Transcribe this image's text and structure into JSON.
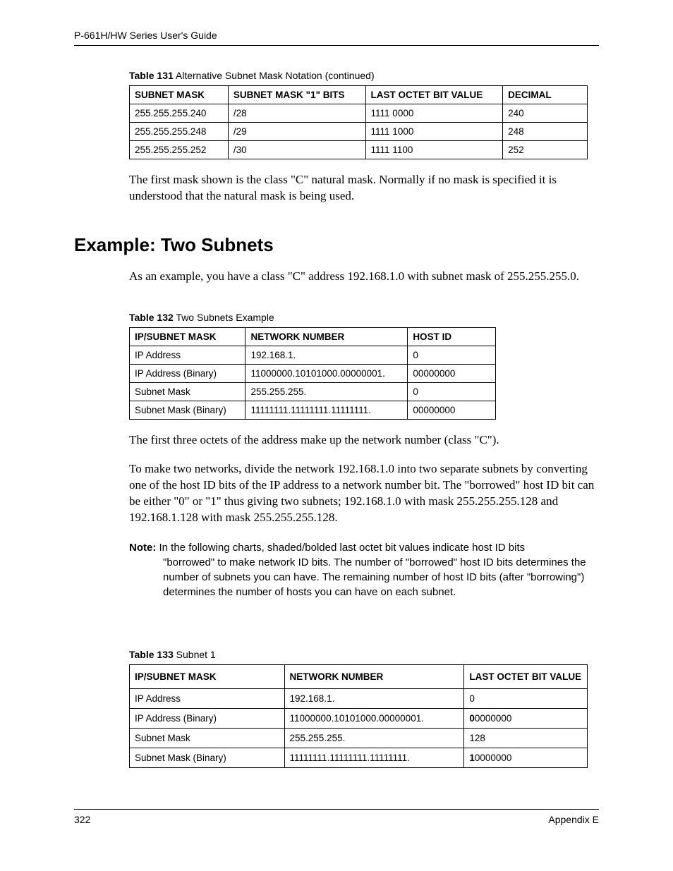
{
  "header": {
    "title": "P-661H/HW Series User's Guide"
  },
  "footer": {
    "page_number": "322",
    "section": "Appendix E"
  },
  "table131": {
    "caption_bold": "Table 131",
    "caption_text": "   Alternative Subnet Mask Notation (continued)",
    "headers": [
      "SUBNET MASK",
      "SUBNET MASK \"1\" BITS",
      "LAST OCTET BIT VALUE",
      "DECIMAL"
    ],
    "rows": [
      [
        "255.255.255.240",
        "/28",
        "1111 0000",
        "240"
      ],
      [
        "255.255.255.248",
        "/29",
        "1111 1000",
        "248"
      ],
      [
        "255.255.255.252",
        "/30",
        "1111 1100",
        "252"
      ]
    ]
  },
  "para1": "The first mask shown is the class \"C\" natural mask. Normally if no mask is specified it is understood that the natural mask is being used.",
  "h2_title": "Example: Two Subnets",
  "para2": "As an example, you have a class \"C\" address 192.168.1.0 with subnet mask of 255.255.255.0.",
  "table132": {
    "caption_bold": "Table 132",
    "caption_text": "   Two Subnets Example",
    "headers": [
      "IP/SUBNET MASK",
      "NETWORK NUMBER",
      "HOST ID"
    ],
    "rows": [
      [
        "IP Address",
        "192.168.1.",
        "0"
      ],
      [
        "IP Address (Binary)",
        "11000000.10101000.00000001.",
        "00000000"
      ],
      [
        "Subnet Mask",
        "255.255.255.",
        "0"
      ],
      [
        "Subnet Mask (Binary)",
        "11111111.11111111.11111111.",
        "00000000"
      ]
    ]
  },
  "para3": "The first three octets of the address make up the network number (class \"C\").",
  "para4": "To make two networks, divide the network 192.168.1.0 into two separate subnets by converting one of the host ID bits of the IP address to a network number bit. The \"borrowed\" host ID bit can be either \"0\" or \"1\" thus giving two subnets; 192.168.1.0 with mask 255.255.255.128 and 192.168.1.128 with mask 255.255.255.128.",
  "note": {
    "label": "Note:",
    "first_line": " In the following charts, shaded/bolded last octet bit values indicate host ID bits",
    "rest": "\"borrowed\" to make network ID bits. The number of \"borrowed\" host ID bits determines the number of subnets you can have. The remaining number of host ID bits  (after \"borrowing\") determines the number of hosts you can have on each subnet."
  },
  "table133": {
    "caption_bold": "Table 133",
    "caption_text": "   Subnet 1",
    "headers": [
      "IP/SUBNET MASK",
      "NETWORK NUMBER",
      "LAST OCTET BIT VALUE"
    ],
    "rows": [
      {
        "c1": "IP Address",
        "c2": "192.168.1.",
        "c3_bold": "",
        "c3_rest": "0"
      },
      {
        "c1": "IP Address (Binary)",
        "c2": "11000000.10101000.00000001.",
        "c3_bold": "0",
        "c3_rest": "0000000"
      },
      {
        "c1": "Subnet Mask",
        "c2": "255.255.255.",
        "c3_bold": "",
        "c3_rest": "128"
      },
      {
        "c1": "Subnet Mask (Binary)",
        "c2": "11111111.11111111.11111111.",
        "c3_bold": "1",
        "c3_rest": "0000000"
      }
    ]
  }
}
